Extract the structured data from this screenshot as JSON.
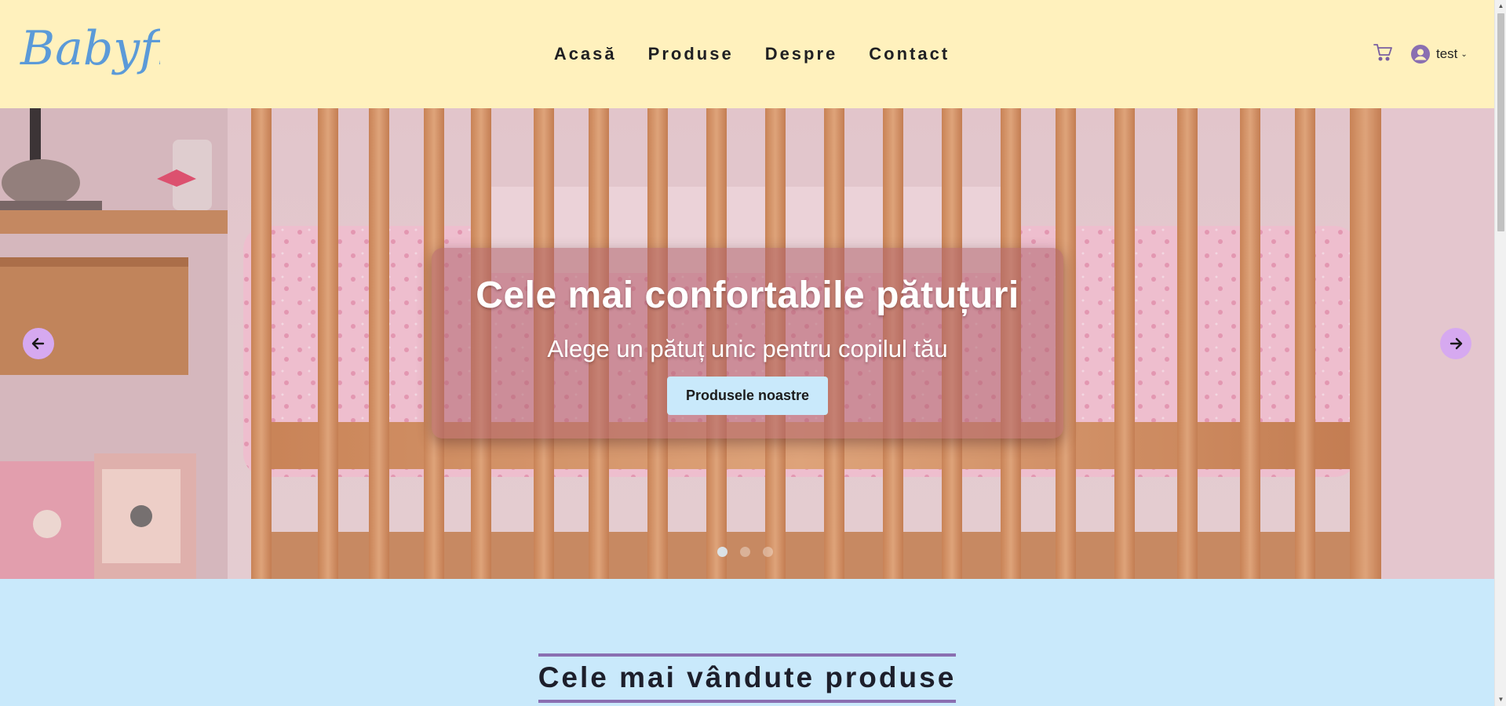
{
  "brand": {
    "logo_text": "Babyfie",
    "logo_color": "#5b9ad8"
  },
  "header": {
    "background": "#fff1bd",
    "nav": [
      {
        "label": "Acasă"
      },
      {
        "label": "Produse"
      },
      {
        "label": "Despre"
      },
      {
        "label": "Contact"
      }
    ],
    "cart_icon": "cart-icon",
    "user": {
      "name": "test",
      "icon": "user-avatar-icon"
    }
  },
  "hero": {
    "title": "Cele mai confortabile pătuțuri",
    "subtitle": "Alege un pătuț unic pentru copilul tău",
    "button_label": "Produsele noastre",
    "slides_total": 3,
    "active_slide": 1,
    "prev_icon": "arrow-left-icon",
    "next_icon": "arrow-right-icon"
  },
  "section": {
    "title": "Cele mai vândute produse"
  },
  "colors": {
    "accent": "#d6a9f0",
    "section_bg": "#c9e9fb",
    "underline": "#8a6fb1"
  }
}
